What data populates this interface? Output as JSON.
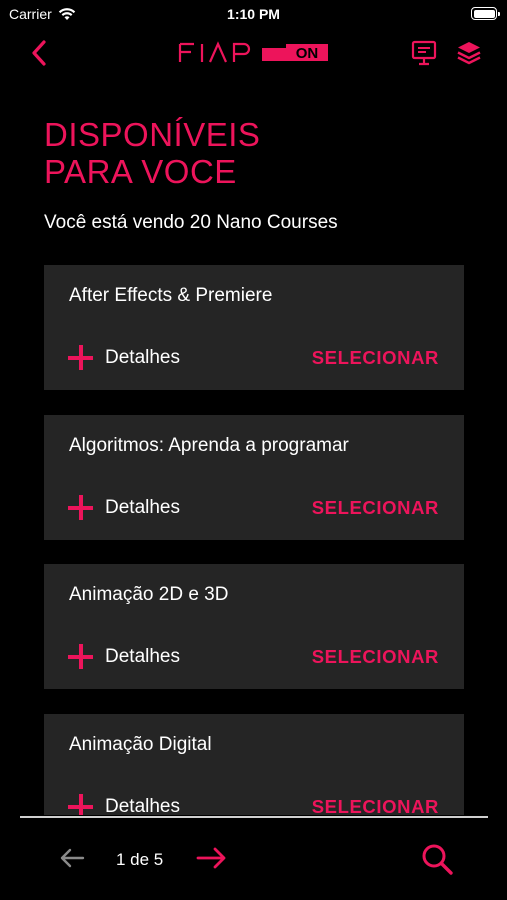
{
  "status_bar": {
    "carrier": "Carrier",
    "time": "1:10 PM"
  },
  "nav": {
    "back_icon": "chevron-left-icon",
    "logo_text": "FIAP",
    "logo_suffix": "ON",
    "actions": [
      "monitor-icon",
      "layers-icon"
    ]
  },
  "header": {
    "title_line1": "DISPONÍVEIS",
    "title_line2": "PARA VOCE",
    "subtitle": "Você está vendo 20 Nano Courses"
  },
  "courses": [
    {
      "title": "After Effects & Premiere",
      "details_label": "Detalhes",
      "select_label": "SELECIONAR"
    },
    {
      "title": "Algoritmos: Aprenda a programar",
      "details_label": "Detalhes",
      "select_label": "SELECIONAR"
    },
    {
      "title": "Animação 2D e 3D",
      "details_label": "Detalhes",
      "select_label": "SELECIONAR"
    },
    {
      "title": "Animação Digital",
      "details_label": "Detalhes",
      "select_label": "SELECIONAR"
    }
  ],
  "pagination": {
    "label": "1 de 5",
    "prev_icon": "arrow-left-icon",
    "next_icon": "arrow-right-icon"
  },
  "search": {
    "icon": "search-icon"
  },
  "colors": {
    "accent": "#ed145b",
    "background": "#000000",
    "card": "#252525",
    "divider": "#cfcfcf"
  }
}
